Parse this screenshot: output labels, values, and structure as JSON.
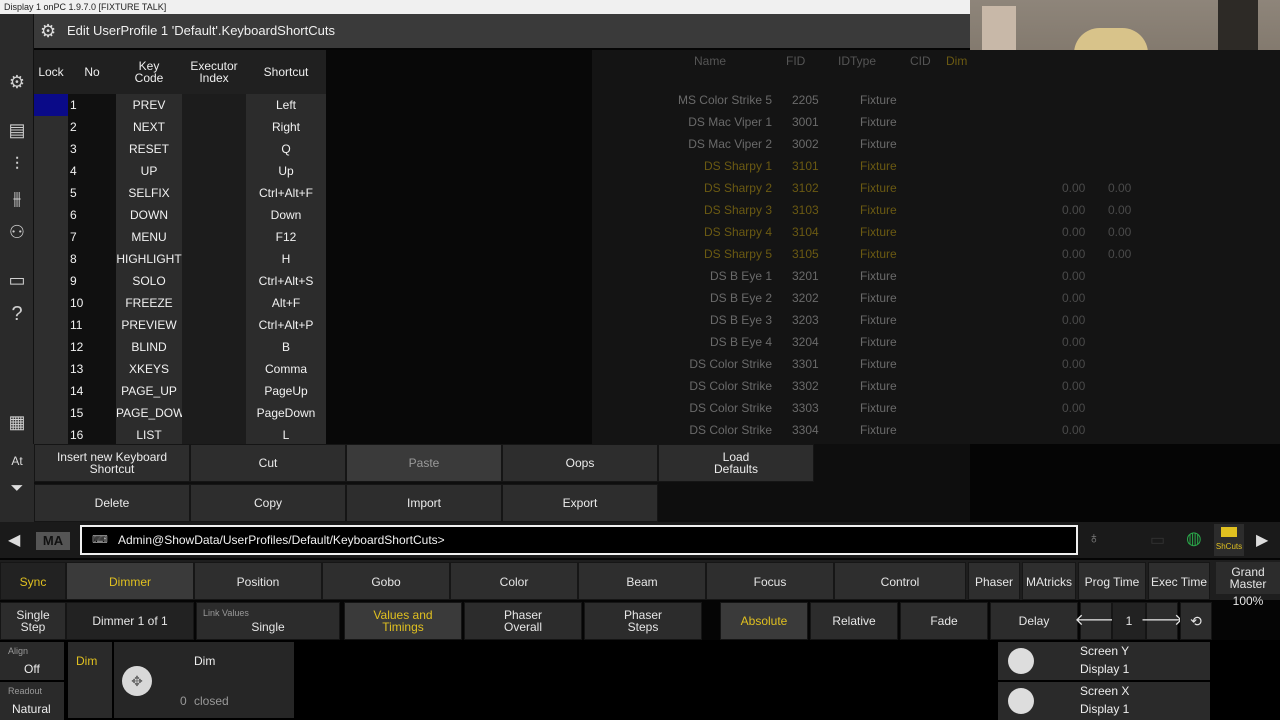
{
  "titlebar": {
    "text": "Display 1 onPC 1.9.7.0 [FIXTURE TALK]"
  },
  "editor": {
    "title": "Edit UserProfile 1 'Default'.KeyboardShortCuts"
  },
  "table": {
    "headers": {
      "lock": "Lock",
      "no": "No",
      "key_code": "Key Code",
      "executor_index": "Executor Index",
      "shortcut": "Shortcut"
    },
    "rows": [
      {
        "no": "1",
        "key": "PREV",
        "shortcut": "Left"
      },
      {
        "no": "2",
        "key": "NEXT",
        "shortcut": "Right"
      },
      {
        "no": "3",
        "key": "RESET",
        "shortcut": "Q"
      },
      {
        "no": "4",
        "key": "UP",
        "shortcut": "Up"
      },
      {
        "no": "5",
        "key": "SELFIX",
        "shortcut": "Ctrl+Alt+F"
      },
      {
        "no": "6",
        "key": "DOWN",
        "shortcut": "Down"
      },
      {
        "no": "7",
        "key": "MENU",
        "shortcut": "F12"
      },
      {
        "no": "8",
        "key": "HIGHLIGHT",
        "shortcut": "H"
      },
      {
        "no": "9",
        "key": "SOLO",
        "shortcut": "Ctrl+Alt+S"
      },
      {
        "no": "10",
        "key": "FREEZE",
        "shortcut": "Alt+F"
      },
      {
        "no": "11",
        "key": "PREVIEW",
        "shortcut": "Ctrl+Alt+P"
      },
      {
        "no": "12",
        "key": "BLIND",
        "shortcut": "B"
      },
      {
        "no": "13",
        "key": "XKEYS",
        "shortcut": "Comma"
      },
      {
        "no": "14",
        "key": "PAGE_UP",
        "shortcut": "PageUp"
      },
      {
        "no": "15",
        "key": "PAGE_DOWI",
        "shortcut": "PageDown"
      },
      {
        "no": "16",
        "key": "LIST",
        "shortcut": "L"
      }
    ]
  },
  "fixtures": {
    "headers": {
      "name": "Name",
      "fid": "FID",
      "idtype": "IDType",
      "cid": "CID",
      "dim": "Dim"
    },
    "rows": [
      {
        "name": "MS Color Strike 5",
        "fid": "2205",
        "type": "Fixture",
        "hl": false,
        "v1": "",
        "v2": ""
      },
      {
        "name": "DS Mac Viper 1",
        "fid": "3001",
        "type": "Fixture",
        "hl": false,
        "v1": "",
        "v2": ""
      },
      {
        "name": "DS Mac Viper 2",
        "fid": "3002",
        "type": "Fixture",
        "hl": false,
        "v1": "",
        "v2": ""
      },
      {
        "name": "DS Sharpy 1",
        "fid": "3101",
        "type": "Fixture",
        "hl": true,
        "v1": "",
        "v2": ""
      },
      {
        "name": "DS Sharpy 2",
        "fid": "3102",
        "type": "Fixture",
        "hl": true,
        "v1": "0.00",
        "v2": "0.00"
      },
      {
        "name": "DS Sharpy 3",
        "fid": "3103",
        "type": "Fixture",
        "hl": true,
        "v1": "0.00",
        "v2": "0.00"
      },
      {
        "name": "DS Sharpy 4",
        "fid": "3104",
        "type": "Fixture",
        "hl": true,
        "v1": "0.00",
        "v2": "0.00"
      },
      {
        "name": "DS Sharpy 5",
        "fid": "3105",
        "type": "Fixture",
        "hl": true,
        "v1": "0.00",
        "v2": "0.00"
      },
      {
        "name": "DS B Eye 1",
        "fid": "3201",
        "type": "Fixture",
        "hl": false,
        "v1": "0.00",
        "v2": ""
      },
      {
        "name": "DS B Eye 2",
        "fid": "3202",
        "type": "Fixture",
        "hl": false,
        "v1": "0.00",
        "v2": ""
      },
      {
        "name": "DS B Eye 3",
        "fid": "3203",
        "type": "Fixture",
        "hl": false,
        "v1": "0.00",
        "v2": ""
      },
      {
        "name": "DS B Eye 4",
        "fid": "3204",
        "type": "Fixture",
        "hl": false,
        "v1": "0.00",
        "v2": ""
      },
      {
        "name": "DS Color Strike",
        "fid": "3301",
        "type": "Fixture",
        "hl": false,
        "v1": "0.00",
        "v2": ""
      },
      {
        "name": "DS Color Strike",
        "fid": "3302",
        "type": "Fixture",
        "hl": false,
        "v1": "0.00",
        "v2": ""
      },
      {
        "name": "DS Color Strike",
        "fid": "3303",
        "type": "Fixture",
        "hl": false,
        "v1": "0.00",
        "v2": ""
      },
      {
        "name": "DS Color Strike",
        "fid": "3304",
        "type": "Fixture",
        "hl": false,
        "v1": "0.00",
        "v2": ""
      }
    ]
  },
  "toolbar": {
    "insert": "Insert new Keyboard Shortcut",
    "cut": "Cut",
    "paste": "Paste",
    "oops": "Oops",
    "load_defaults": "Load Defaults",
    "delete": "Delete",
    "copy": "Copy",
    "import": "Import",
    "export": "Export"
  },
  "sidebar": {
    "at": "At"
  },
  "cmd": {
    "logo": "MA",
    "path": "Admin@ShowData/UserProfiles/Default/KeyboardShortCuts>",
    "shcuts": "ShCuts"
  },
  "presets": {
    "sync": "Sync",
    "dimmer": "Dimmer",
    "position": "Position",
    "gobo": "Gobo",
    "color": "Color",
    "beam": "Beam",
    "focus": "Focus",
    "control": "Control",
    "phaser": "Phaser",
    "matricks": "MAtricks",
    "prog_time": "Prog Time",
    "exec_time": "Exec Time",
    "grand_master": "Grand Master",
    "gm_value": "100%"
  },
  "second": {
    "single_step": "Single Step",
    "dimmer_of": "Dimmer 1 of 1",
    "link_values_label": "Link Values",
    "link_values": "Single",
    "values_timings": "Values and Timings",
    "phaser_overall": "Phaser Overall",
    "phaser_steps": "Phaser Steps",
    "absolute": "Absolute",
    "relative": "Relative",
    "fade": "Fade",
    "delay": "Delay",
    "page": "1"
  },
  "bottom": {
    "align_label": "Align",
    "align": "Off",
    "readout_label": "Readout",
    "readout": "Natural",
    "dim_tab": "Dim",
    "dim_title": "Dim",
    "dim_value": "0",
    "dim_state": "closed",
    "screen_y": "Screen Y",
    "screen_y_display": "Display 1",
    "screen_x": "Screen X",
    "screen_x_display": "Display 1"
  }
}
